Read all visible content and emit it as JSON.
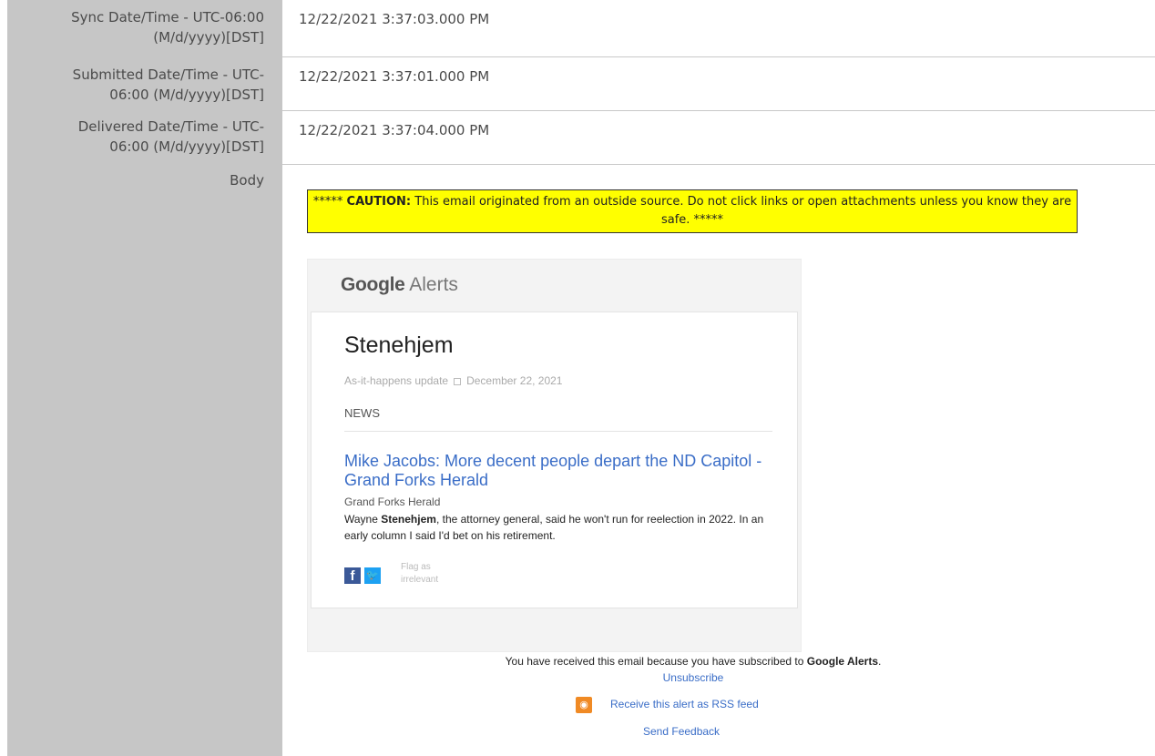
{
  "rows": [
    {
      "label_line1": "Sync Date/Time - UTC-06:00",
      "label_line2": "(M/d/yyyy)[DST]",
      "value": "12/22/2021 3:37:03.000 PM"
    },
    {
      "label_line1": "Submitted Date/Time - UTC-",
      "label_line2": "06:00 (M/d/yyyy)[DST]",
      "value": "12/22/2021 3:37:01.000 PM"
    },
    {
      "label_line1": "Delivered Date/Time - UTC-",
      "label_line2": "06:00 (M/d/yyyy)[DST]",
      "value": "12/22/2021 3:37:04.000 PM"
    }
  ],
  "body_label": "Body",
  "caution": {
    "prefix": "*****",
    "bold": "CAUTION:",
    "text": "This email originated from an outside source. Do not click links or open attachments unless you know they are safe. *****"
  },
  "alert": {
    "brand_google": "Google",
    "brand_alerts": "Alerts",
    "topic": "Stenehjem",
    "update_type": "As-it-happens update",
    "date": "December 22, 2021",
    "section": "NEWS",
    "headline": "Mike Jacobs: More decent people depart the ND Capitol - Grand Forks Herald",
    "source": "Grand Forks Herald",
    "snippet_pre": "Wayne ",
    "snippet_bold": "Stenehjem",
    "snippet_post": ", the attorney general, said he won't run for reelection in 2022. In an early column I said I'd bet on his retirement.",
    "flag_text": "Flag as irrelevant"
  },
  "footer": {
    "received_pre": "You have received this email because you have subscribed to ",
    "received_bold": "Google Alerts",
    "received_post": ".",
    "unsubscribe": "Unsubscribe",
    "rss": "Receive this alert as RSS feed",
    "feedback": "Send Feedback"
  },
  "colors": {
    "caution_bg": "#ffff00",
    "link": "#3a6dc7",
    "label_col": "#c6c6c6"
  },
  "icons": [
    "facebook-icon",
    "twitter-icon",
    "rss-icon",
    "checkbox-icon"
  ]
}
